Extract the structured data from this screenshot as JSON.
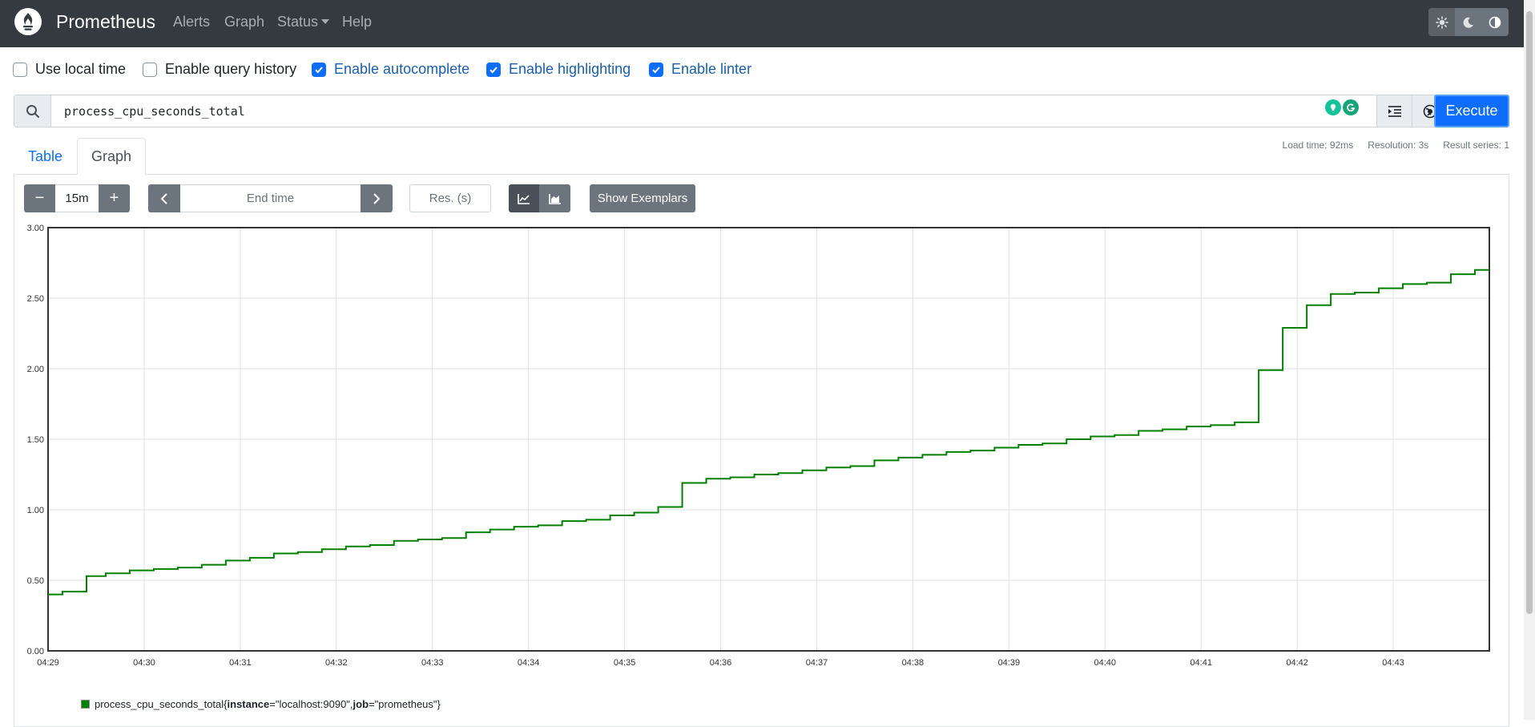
{
  "navbar": {
    "brand": "Prometheus",
    "links": [
      "Alerts",
      "Graph",
      "Status",
      "Help"
    ],
    "logo_icon": "prometheus-flame-icon",
    "theme_icons": [
      "sun-icon",
      "moon-icon",
      "half-circle-icon"
    ],
    "background": "#343a40"
  },
  "options": {
    "local_time": {
      "label": "Use local time",
      "checked": false
    },
    "query_history": {
      "label": "Enable query history",
      "checked": false
    },
    "autocomplete": {
      "label": "Enable autocomplete",
      "checked": true
    },
    "highlighting": {
      "label": "Enable highlighting",
      "checked": true
    },
    "linter": {
      "label": "Enable linter",
      "checked": true
    }
  },
  "query": {
    "value": "process_cpu_seconds_total",
    "search_icon": "search-icon",
    "tool_icons": [
      "format-indent-icon",
      "metrics-explorer-icon"
    ],
    "execute_label": "Execute",
    "accent": "#0d6efd"
  },
  "tabs": {
    "table": "Table",
    "graph": "Graph",
    "active": "Graph"
  },
  "stats": {
    "load_time": "Load time: 92ms",
    "resolution": "Resolution: 3s",
    "result_series": "Result series: 1"
  },
  "graph_controls": {
    "minus": "−",
    "range": "15m",
    "plus": "+",
    "end_time_placeholder": "End time",
    "resolution_placeholder": "Res. (s)",
    "stacked_icons": [
      "line-chart-icon",
      "stacked-area-chart-icon"
    ],
    "exemplars_label": "Show Exemplars"
  },
  "legend": {
    "metric": "process_cpu_seconds_total",
    "open": "{",
    "l1_key": "instance",
    "l1_val": "=\"localhost:9090\", ",
    "l2_key": "job",
    "l2_val": "=\"prometheus\"}",
    "color": "#008000"
  },
  "chart_data": {
    "type": "line",
    "title": "",
    "xlabel": "",
    "ylabel": "",
    "ylim": [
      0,
      3
    ],
    "yticks": [
      "0.00",
      "0.50",
      "1.00",
      "1.50",
      "2.00",
      "2.50",
      "3.00"
    ],
    "xlim": [
      0,
      15
    ],
    "xticks": [
      "04:29",
      "04:30",
      "04:31",
      "04:32",
      "04:33",
      "04:34",
      "04:35",
      "04:36",
      "04:37",
      "04:38",
      "04:39",
      "04:40",
      "04:41",
      "04:42",
      "04:43"
    ],
    "grid": true,
    "step": true,
    "series": [
      {
        "name": "process_cpu_seconds_total{instance=\"localhost:9090\", job=\"prometheus\"}",
        "color": "#008000",
        "x": [
          0,
          0.15,
          0.4,
          0.6,
          0.85,
          1.1,
          1.35,
          1.6,
          1.85,
          2.1,
          2.35,
          2.6,
          2.85,
          3.1,
          3.35,
          3.6,
          3.85,
          4.1,
          4.35,
          4.6,
          4.85,
          5.1,
          5.35,
          5.6,
          5.85,
          6.1,
          6.35,
          6.6,
          6.85,
          7.1,
          7.35,
          7.6,
          7.85,
          8.1,
          8.35,
          8.6,
          8.85,
          9.1,
          9.35,
          9.6,
          9.85,
          10.1,
          10.35,
          10.6,
          10.85,
          11.1,
          11.35,
          11.6,
          11.85,
          12.1,
          12.35,
          12.6,
          12.85,
          13.1,
          13.35,
          13.6,
          13.85,
          14.1,
          14.35,
          14.6,
          14.85,
          15.0
        ],
        "y": [
          0.4,
          0.42,
          0.53,
          0.55,
          0.57,
          0.58,
          0.59,
          0.61,
          0.64,
          0.66,
          0.69,
          0.7,
          0.72,
          0.74,
          0.75,
          0.78,
          0.79,
          0.8,
          0.84,
          0.86,
          0.88,
          0.89,
          0.92,
          0.93,
          0.96,
          0.98,
          1.02,
          1.19,
          1.22,
          1.23,
          1.25,
          1.26,
          1.28,
          1.3,
          1.31,
          1.35,
          1.37,
          1.39,
          1.41,
          1.42,
          1.44,
          1.46,
          1.47,
          1.5,
          1.52,
          1.53,
          1.56,
          1.57,
          1.59,
          1.6,
          1.62,
          1.99,
          2.29,
          2.45,
          2.53,
          2.54,
          2.57,
          2.6,
          2.61,
          2.67,
          2.7,
          2.7
        ]
      }
    ]
  }
}
